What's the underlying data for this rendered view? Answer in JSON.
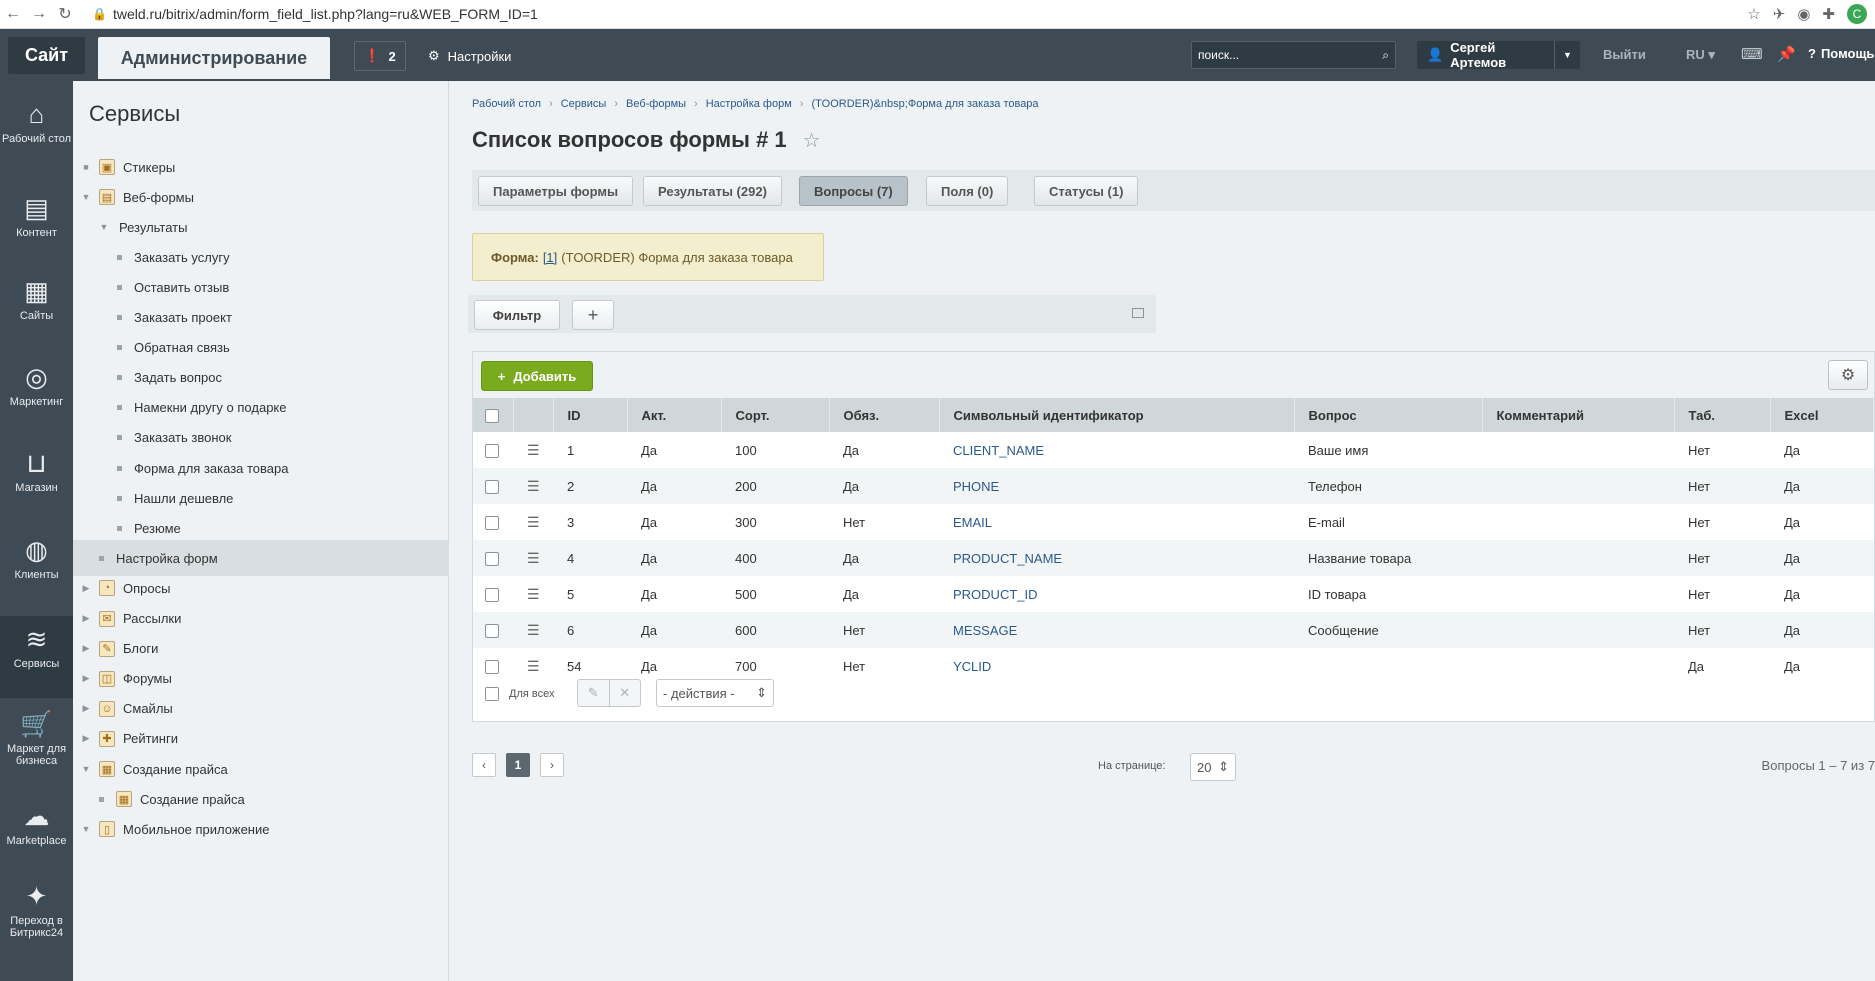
{
  "browser": {
    "url": "tweld.ru/bitrix/admin/form_field_list.php?lang=ru&WEB_FORM_ID=1",
    "avatar_letter": "C"
  },
  "top": {
    "site_tab": "Сайт",
    "admin_tab": "Администрирование",
    "notifications_count": "2",
    "settings": "Настройки",
    "search_placeholder": "поиск...",
    "user_name": "Сергей Артемов",
    "logout": "Выйти",
    "lang": "RU",
    "help": "Помощь"
  },
  "icon_menu": [
    {
      "label": "Рабочий стол",
      "icon": "home-icon"
    },
    {
      "label": "Контент",
      "icon": "document-icon"
    },
    {
      "label": "Сайты",
      "icon": "calendar-24-icon"
    },
    {
      "label": "Маркетинг",
      "icon": "target-icon"
    },
    {
      "label": "Магазин",
      "icon": "basket-icon"
    },
    {
      "label": "Клиенты",
      "icon": "clients-icon"
    },
    {
      "label": "Сервисы",
      "icon": "layers-icon"
    },
    {
      "label": "Маркет для бизнеса",
      "icon": "cart-icon"
    },
    {
      "label": "Marketplace",
      "icon": "cloud-download-icon"
    },
    {
      "label": "Переход в Битрикс24",
      "icon": "magic-icon"
    }
  ],
  "tree": {
    "title": "Сервисы",
    "items": [
      {
        "label": "Стикеры",
        "level": 0,
        "arrow": "none",
        "icon": "sticker-icon"
      },
      {
        "label": "Веб-формы",
        "level": 0,
        "arrow": "down",
        "icon": "webform-icon"
      },
      {
        "label": "Результаты",
        "level": 1,
        "arrow": "down"
      },
      {
        "label": "Заказать услугу",
        "level": 2
      },
      {
        "label": "Оставить отзыв",
        "level": 2
      },
      {
        "label": "Заказать проект",
        "level": 2
      },
      {
        "label": "Обратная связь",
        "level": 2
      },
      {
        "label": "Задать вопрос",
        "level": 2
      },
      {
        "label": "Намекни другу о подарке",
        "level": 2
      },
      {
        "label": "Заказать звонок",
        "level": 2
      },
      {
        "label": "Форма для заказа товара",
        "level": 2
      },
      {
        "label": "Нашли дешевле",
        "level": 2
      },
      {
        "label": "Резюме",
        "level": 2
      },
      {
        "label": "Настройка форм",
        "level": 1,
        "selected": true
      },
      {
        "label": "Опросы",
        "level": 0,
        "arrow": "right",
        "icon": "poll-icon"
      },
      {
        "label": "Рассылки",
        "level": 0,
        "arrow": "right",
        "icon": "mail-icon"
      },
      {
        "label": "Блоги",
        "level": 0,
        "arrow": "right",
        "icon": "blog-icon"
      },
      {
        "label": "Форумы",
        "level": 0,
        "arrow": "right",
        "icon": "forum-icon"
      },
      {
        "label": "Смайлы",
        "level": 0,
        "arrow": "right",
        "icon": "smile-icon"
      },
      {
        "label": "Рейтинги",
        "level": 0,
        "arrow": "right",
        "icon": "rating-icon"
      },
      {
        "label": "Создание прайса",
        "level": 0,
        "arrow": "down",
        "icon": "price-icon"
      },
      {
        "label": "Создание прайса",
        "level": 1,
        "icon": "price-icon"
      },
      {
        "label": "Мобильное приложение",
        "level": 0,
        "arrow": "down",
        "icon": "mobile-icon"
      }
    ]
  },
  "breadcrumb": [
    "Рабочий стол",
    "Сервисы",
    "Веб-формы",
    "Настройка форм",
    "(TOORDER)&nbsp;Форма для заказа товара"
  ],
  "page_title": "Список вопросов формы # 1",
  "tabs": [
    {
      "label": "Параметры формы",
      "active": false
    },
    {
      "label": "Результаты (292)",
      "active": false
    },
    {
      "label": "Вопросы (7)",
      "active": true
    },
    {
      "label": "Поля (0)",
      "active": false
    },
    {
      "label": "Статусы (1)",
      "active": false
    }
  ],
  "form_note": {
    "label": "Форма:",
    "link": "[1]",
    "text": "(TOORDER) Форма для заказа товара"
  },
  "filter": {
    "label": "Фильтр"
  },
  "grid": {
    "add_label": "Добавить",
    "columns": [
      "ID",
      "Акт.",
      "Сорт.",
      "Обяз.",
      "Символьный идентификатор",
      "Вопрос",
      "Комментарий",
      "Таб.",
      "Excel"
    ],
    "rows": [
      {
        "id": "1",
        "active": "Да",
        "sort": "100",
        "required": "Да",
        "code": "CLIENT_NAME",
        "question": "Ваше имя",
        "comment": "",
        "tab": "Нет",
        "excel": "Да"
      },
      {
        "id": "2",
        "active": "Да",
        "sort": "200",
        "required": "Да",
        "code": "PHONE",
        "question": "Телефон",
        "comment": "",
        "tab": "Нет",
        "excel": "Да"
      },
      {
        "id": "3",
        "active": "Да",
        "sort": "300",
        "required": "Нет",
        "code": "EMAIL",
        "question": "E-mail",
        "comment": "",
        "tab": "Нет",
        "excel": "Да"
      },
      {
        "id": "4",
        "active": "Да",
        "sort": "400",
        "required": "Да",
        "code": "PRODUCT_NAME",
        "question": "Название товара",
        "comment": "",
        "tab": "Нет",
        "excel": "Да"
      },
      {
        "id": "5",
        "active": "Да",
        "sort": "500",
        "required": "Да",
        "code": "PRODUCT_ID",
        "question": "ID товара",
        "comment": "",
        "tab": "Нет",
        "excel": "Да"
      },
      {
        "id": "6",
        "active": "Да",
        "sort": "600",
        "required": "Нет",
        "code": "MESSAGE",
        "question": "Сообщение",
        "comment": "",
        "tab": "Нет",
        "excel": "Да"
      },
      {
        "id": "54",
        "active": "Да",
        "sort": "700",
        "required": "Нет",
        "code": "YCLID",
        "question": "",
        "comment": "",
        "tab": "Да",
        "excel": "Да"
      }
    ],
    "for_all": "Для всех",
    "actions": "- действия -"
  },
  "pager": {
    "current": "1",
    "per_page_label": "На странице:",
    "per_page": "20",
    "total": "Вопросы 1 – 7 из 7"
  },
  "colors": {
    "accent": "#7aab1f",
    "panel": "#3f4b54",
    "link": "#2a5a8a"
  }
}
